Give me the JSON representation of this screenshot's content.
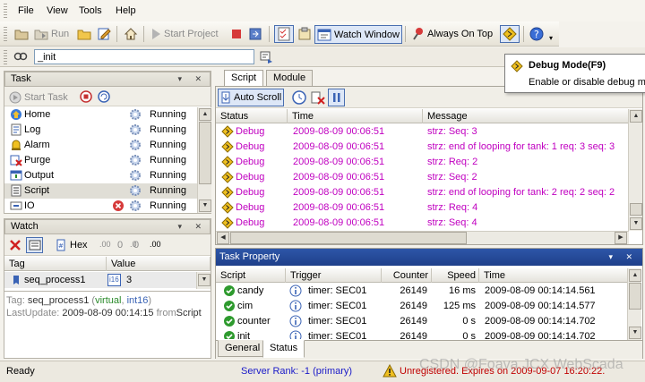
{
  "menu": {
    "file": "File",
    "view": "View",
    "tools": "Tools",
    "help": "Help"
  },
  "toolbar": {
    "run": "Run",
    "start_project": "Start Project",
    "watch_window": "Watch Window",
    "always_on_top": "Always On Top"
  },
  "command": {
    "value": "_init"
  },
  "tooltip": {
    "title": "Debug Mode(F9)",
    "body": "Enable or disable debug mo"
  },
  "task_panel": {
    "title": "Task",
    "start_task": "Start Task",
    "items": [
      {
        "name": "Home",
        "status": "Running",
        "icon": "home-icon"
      },
      {
        "name": "Log",
        "status": "Running",
        "icon": "log-icon"
      },
      {
        "name": "Alarm",
        "status": "Running",
        "icon": "alarm-icon"
      },
      {
        "name": "Purge",
        "status": "Running",
        "icon": "purge-icon"
      },
      {
        "name": "Output",
        "status": "Running",
        "icon": "output-icon"
      },
      {
        "name": "Script",
        "status": "Running",
        "icon": "script-icon"
      },
      {
        "name": "IO",
        "status": "Running",
        "icon": "io-icon"
      }
    ]
  },
  "watch_panel": {
    "title": "Watch",
    "hex": "Hex",
    "count1": "0",
    "count2": "0",
    "columns": {
      "tag": "Tag",
      "value": "Value"
    },
    "row": {
      "tag": "seq_process1",
      "type": "i16",
      "value": "3"
    },
    "info": {
      "tag_label": "Tag:",
      "tag_name": "seq_process1",
      "virtual": "virtual",
      "int16": "int16",
      "last_update_label": "LastUpdate:",
      "last_update": "2009-08-09 00:14:15",
      "from_label": "from",
      "from_value": "Script"
    }
  },
  "script_panel": {
    "tabs": [
      "Script",
      "Module"
    ],
    "auto_scroll": "Auto Scroll",
    "columns": {
      "status": "Status",
      "time": "Time",
      "message": "Message"
    },
    "rows": [
      {
        "status": "Debug",
        "time": "2009-08-09 00:06:51",
        "message": "strz: Seq: 3"
      },
      {
        "status": "Debug",
        "time": "2009-08-09 00:06:51",
        "message": "strz: end of looping for tank: 1 req: 3 seq: 3"
      },
      {
        "status": "Debug",
        "time": "2009-08-09 00:06:51",
        "message": "strz: Req: 2"
      },
      {
        "status": "Debug",
        "time": "2009-08-09 00:06:51",
        "message": "strz: Seq: 2"
      },
      {
        "status": "Debug",
        "time": "2009-08-09 00:06:51",
        "message": "strz: end of looping for tank: 2 req: 2 seq: 2"
      },
      {
        "status": "Debug",
        "time": "2009-08-09 00:06:51",
        "message": "strz: Req: 4"
      },
      {
        "status": "Debug",
        "time": "2009-08-09 00:06:51",
        "message": "strz: Seq: 4"
      }
    ]
  },
  "task_property": {
    "title": "Task Property",
    "columns": {
      "script": "Script",
      "trigger": "Trigger",
      "counter": "Counter",
      "speed": "Speed",
      "time": "Time"
    },
    "rows": [
      {
        "script": "candy",
        "trigger": "timer: SEC01",
        "counter": "26149",
        "speed": "16 ms",
        "time": "2009-08-09 00:14:14.561"
      },
      {
        "script": "cim",
        "trigger": "timer: SEC01",
        "counter": "26149",
        "speed": "125 ms",
        "time": "2009-08-09 00:14:14.577"
      },
      {
        "script": "counter",
        "trigger": "timer: SEC01",
        "counter": "26149",
        "speed": "0 s",
        "time": "2009-08-09 00:14:14.702"
      },
      {
        "script": "init",
        "trigger": "timer: SEC01",
        "counter": "26149",
        "speed": "0 s",
        "time": "2009-08-09 00:14:14.702"
      }
    ],
    "tabs": [
      "General",
      "Status"
    ]
  },
  "statusbar": {
    "ready": "Ready",
    "server_rank": "Server Rank: -1 (primary)",
    "unregistered": "Unregistered. Expires on 2009-09-07 16:20:22.",
    "watermark": "CSDN @Foava JCX WebScada"
  },
  "colors": {
    "debug": "#c000c0",
    "server_rank": "#1a1ac8",
    "unregistered": "#c00000",
    "selection": "#0a246a"
  }
}
